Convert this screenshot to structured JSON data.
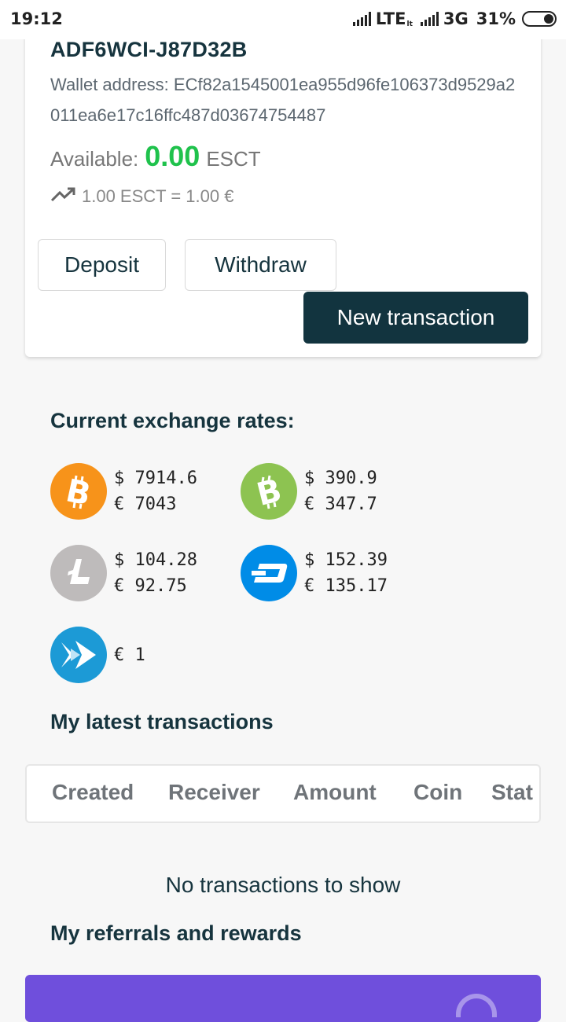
{
  "status_bar": {
    "time": "19:12",
    "network1": "LTE",
    "network1_sub": "lt",
    "network2": "3G",
    "battery": "31%"
  },
  "wallet": {
    "id": "ADF6WCI-J87D32B",
    "address_label": "Wallet address: ",
    "address": "ECf82a1545001ea955d96fe106373d9529a2011ea6e17c16ffc487d03674754487",
    "available_label": "Available:",
    "available_amount": "0.00",
    "currency": "ESCT",
    "rate_text": "1.00 ESCT = 1.00 €",
    "deposit_label": "Deposit",
    "withdraw_label": "Withdraw",
    "new_transaction_label": "New transaction"
  },
  "exchange": {
    "title": "Current exchange rates:",
    "coins": [
      {
        "icon": "bitcoin-icon",
        "color": "#f7931a",
        "usd": "$ 7914.6",
        "eur": "€ 7043"
      },
      {
        "icon": "bitcoin-cash-icon",
        "color": "#8dc351",
        "usd": "$ 390.9",
        "eur": "€ 347.7"
      },
      {
        "icon": "litecoin-icon",
        "color": "#bebbbb",
        "usd": "$ 104.28",
        "eur": "€ 92.75"
      },
      {
        "icon": "dash-icon",
        "color": "#008ce7",
        "usd": "$ 152.39",
        "eur": "€ 135.17"
      },
      {
        "icon": "escoin-icon",
        "color": "#1c9ad6",
        "eur": "€ 1"
      }
    ]
  },
  "transactions": {
    "title": "My latest transactions",
    "columns": [
      "Created",
      "Receiver",
      "Amount",
      "Coin",
      "Stat"
    ],
    "empty_text": "No transactions to show"
  },
  "referrals": {
    "title": "My referrals and rewards",
    "banner_color": "#6f4fdc"
  },
  "colors": {
    "primary_dark": "#12343f",
    "positive": "#1fc24c"
  }
}
